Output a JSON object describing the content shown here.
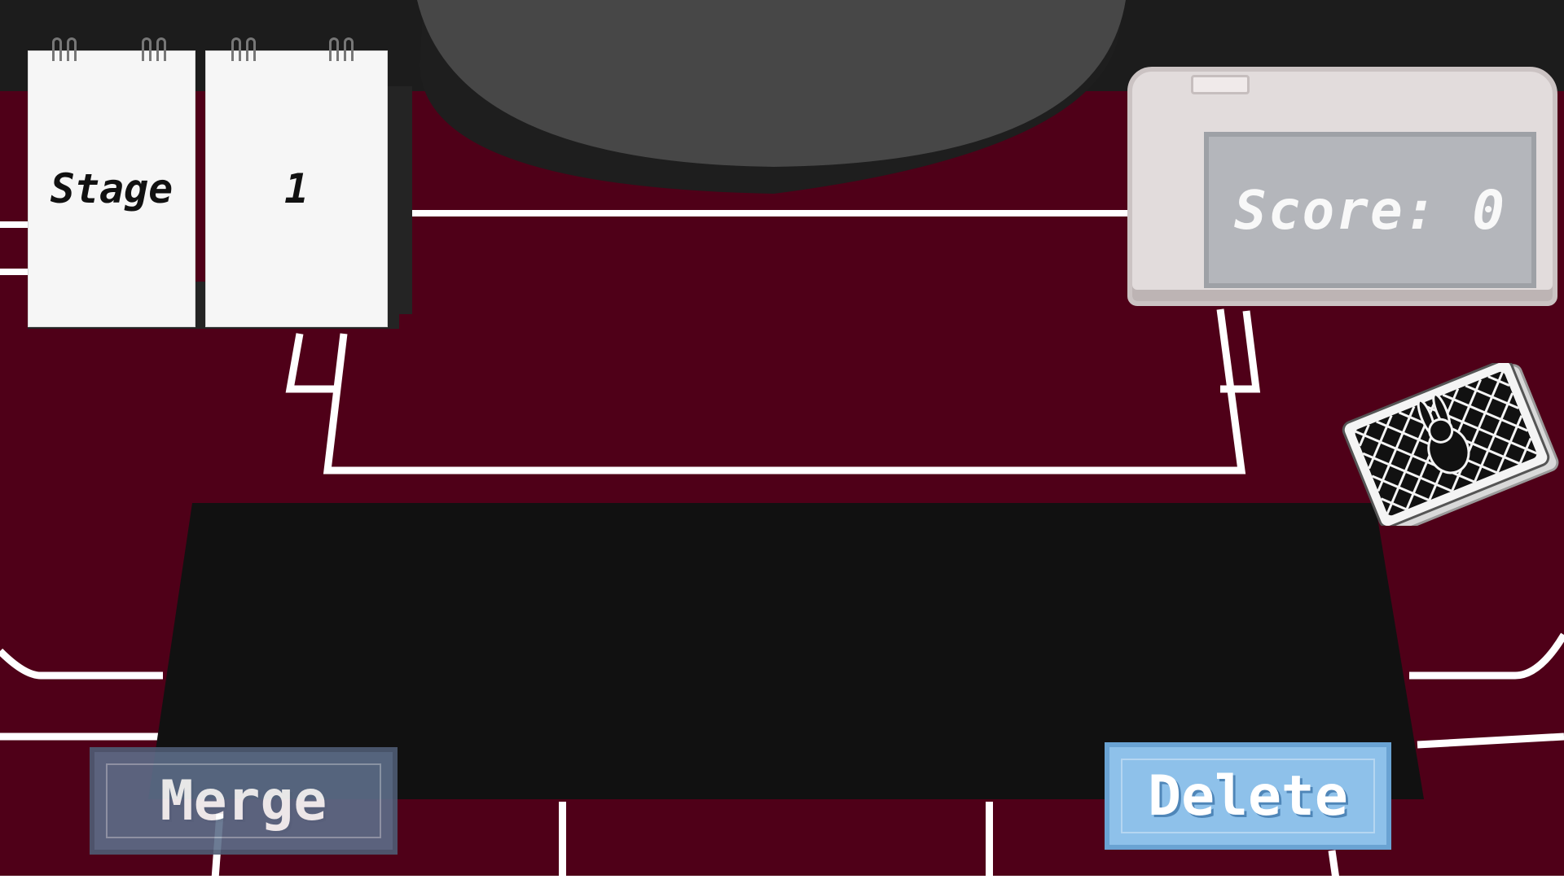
{
  "stage": {
    "label": "Stage",
    "number": "1"
  },
  "score": {
    "text": "Score: 0"
  },
  "buttons": {
    "merge_label": "Merge",
    "delete_label": "Delete"
  },
  "colors": {
    "table_felt": "#4f0018",
    "table_lines": "#ffffff",
    "play_mat": "#111111",
    "merge_button": "#5d6d89",
    "delete_button": "#8ec1ea"
  },
  "icons": {
    "card_back": "rabbit-card-back-icon"
  }
}
